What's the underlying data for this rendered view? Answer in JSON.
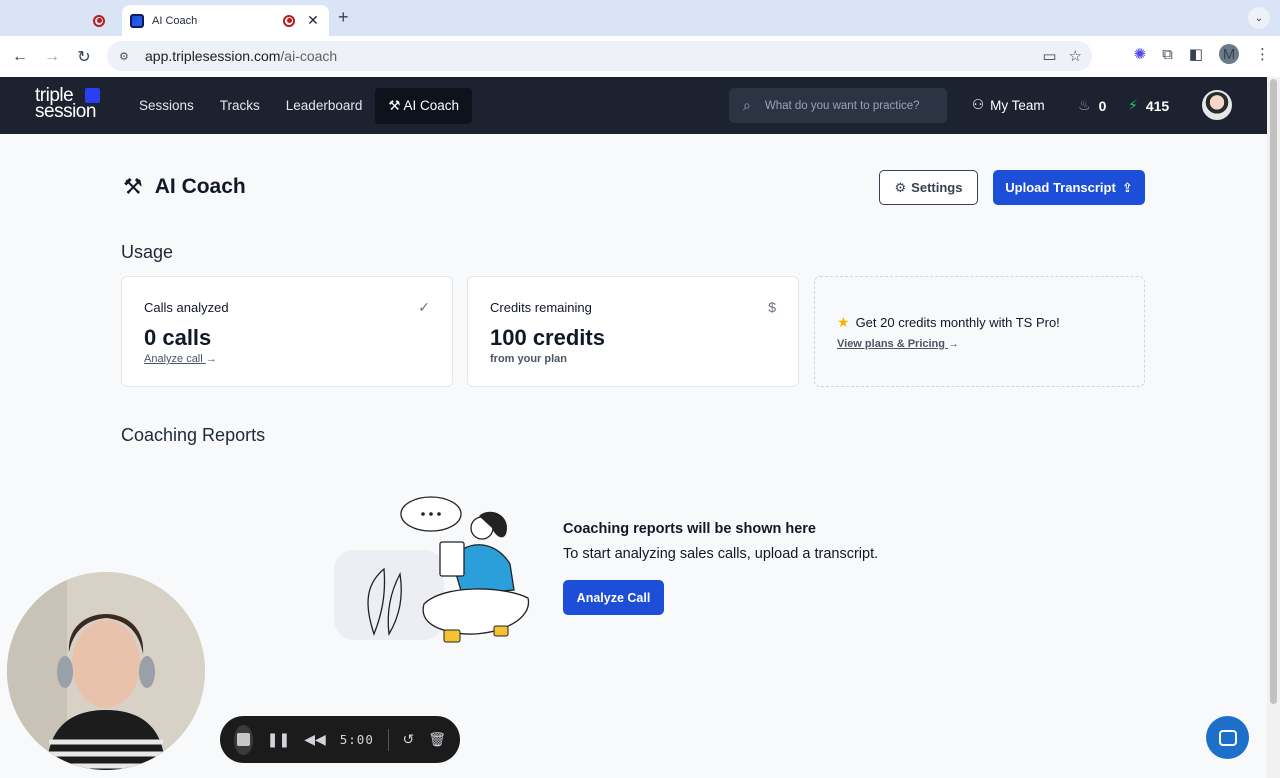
{
  "browser": {
    "tabs": [
      {
        "title": "",
        "active": false
      },
      {
        "title": "AI Coach",
        "active": true
      }
    ],
    "close_glyph": "✕",
    "new_tab_glyph": "+",
    "url_host": "app.triplesession.com",
    "url_path": "/ai-coach",
    "profile_initial": "M"
  },
  "app": {
    "logo_line1": "triple",
    "logo_line2": "session",
    "nav": [
      "Sessions",
      "Tracks",
      "Leaderboard",
      "AI Coach"
    ],
    "active_nav": "AI Coach",
    "search_placeholder": "What do you want to practice?",
    "my_team_label": "My Team",
    "streak_count": "0",
    "points_count": "415"
  },
  "page": {
    "title": "AI Coach",
    "settings_label": "Settings",
    "upload_label": "Upload Transcript",
    "usage_title": "Usage",
    "cards": {
      "calls": {
        "label": "Calls analyzed",
        "value": "0 calls",
        "link": "Analyze call",
        "corner_icon": "check-icon"
      },
      "credits": {
        "label": "Credits remaining",
        "value": "100 credits",
        "sub": "from your plan",
        "corner_icon": "dollar-icon"
      },
      "promo": {
        "text": "Get 20 credits monthly with TS Pro!",
        "link": "View plans & Pricing"
      }
    },
    "reports_title": "Coaching Reports",
    "empty_heading": "Coaching reports will be shown here",
    "empty_sub": "To start analyzing sales calls, upload a transcript.",
    "analyze_label": "Analyze Call"
  },
  "recorder": {
    "time": "5:00"
  },
  "colors": {
    "appbar": "#1c2230",
    "primary": "#1d4ed8",
    "bolt": "#22c55e",
    "star": "#f5b301"
  }
}
